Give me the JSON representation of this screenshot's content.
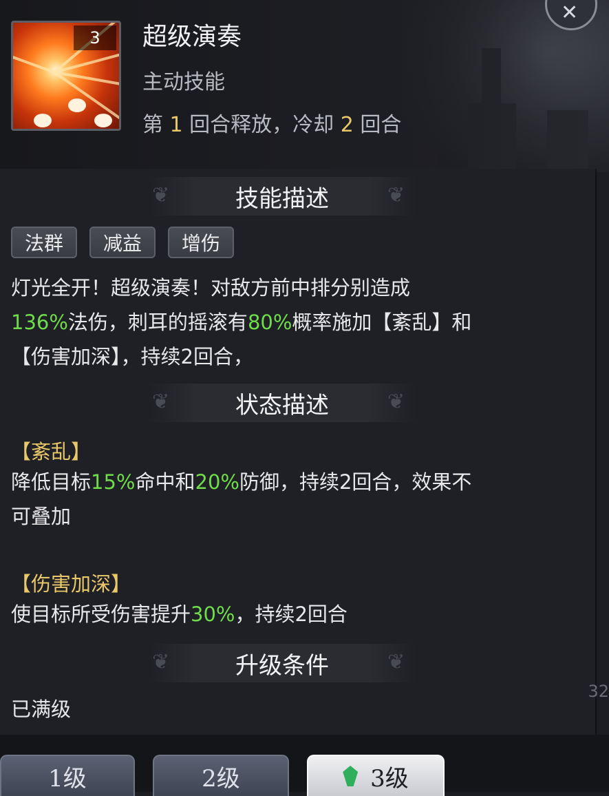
{
  "skill": {
    "level_badge": "3",
    "name": "超级演奏",
    "type": "主动技能",
    "cd_prefix": "第 ",
    "cd_turn": "1",
    "cd_middle": " 回合释放，冷却 ",
    "cd_value": "2",
    "cd_suffix": " 回合"
  },
  "sections": {
    "skill_desc_title": "技能描述",
    "status_desc_title": "状态描述",
    "upgrade_title": "升级条件"
  },
  "tags": [
    "法群",
    "减益",
    "增伤"
  ],
  "skill_desc": {
    "line1": "灯光全开！超级演奏！对敌方前中排分别造成",
    "line2_a": "136%",
    "line2_b": "法伤，刺耳的摇滚有",
    "line2_c": "80%",
    "line2_d": "概率施加【紊乱】和",
    "line3": "【伤害加深】，持续2回合，"
  },
  "statuses": [
    {
      "name": "【紊乱】",
      "l1_a": "降低目标",
      "l1_b": "15%",
      "l1_c": "命中和",
      "l1_d": "20%",
      "l1_e": "防御，持续2回合，效果不",
      "l2": "可叠加"
    },
    {
      "name": "【伤害加深】",
      "l1_a": "使目标所受伤害提升",
      "l1_b": "30%",
      "l1_c": "，持续2回合"
    }
  ],
  "upgrade": {
    "text": "已满级"
  },
  "level_tabs": [
    "1级",
    "2级",
    "3级"
  ],
  "side_number": "32",
  "colors": {
    "highlight_green": "#6fdc4a",
    "status_gold": "#e9c86a",
    "panel_bg": "#1f2025"
  }
}
